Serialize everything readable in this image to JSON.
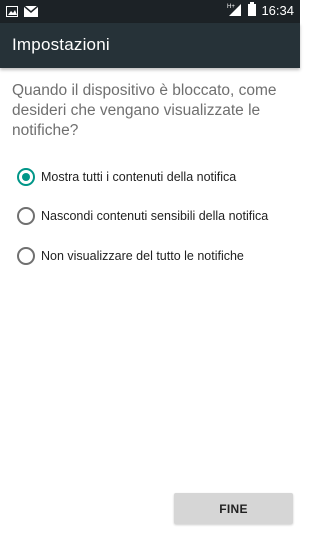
{
  "status_bar": {
    "time": "16:34",
    "network": "H+",
    "icons": [
      "image-icon",
      "email-icon",
      "signal-icon",
      "battery-icon"
    ]
  },
  "toolbar": {
    "title": "Impostazioni"
  },
  "question": "Quando il dispositivo è bloccato, come desideri che vengano visualizzate le notifiche?",
  "options": [
    {
      "label": "Mostra tutti i contenuti della notifica",
      "selected": true
    },
    {
      "label": "Nascondi contenuti sensibili della notifica",
      "selected": false
    },
    {
      "label": "Non visualizzare del tutto le notifiche",
      "selected": false
    }
  ],
  "button": {
    "label": "FINE"
  },
  "colors": {
    "accent": "#009688",
    "toolbar": "#263238",
    "status_bar": "#1c2226"
  }
}
